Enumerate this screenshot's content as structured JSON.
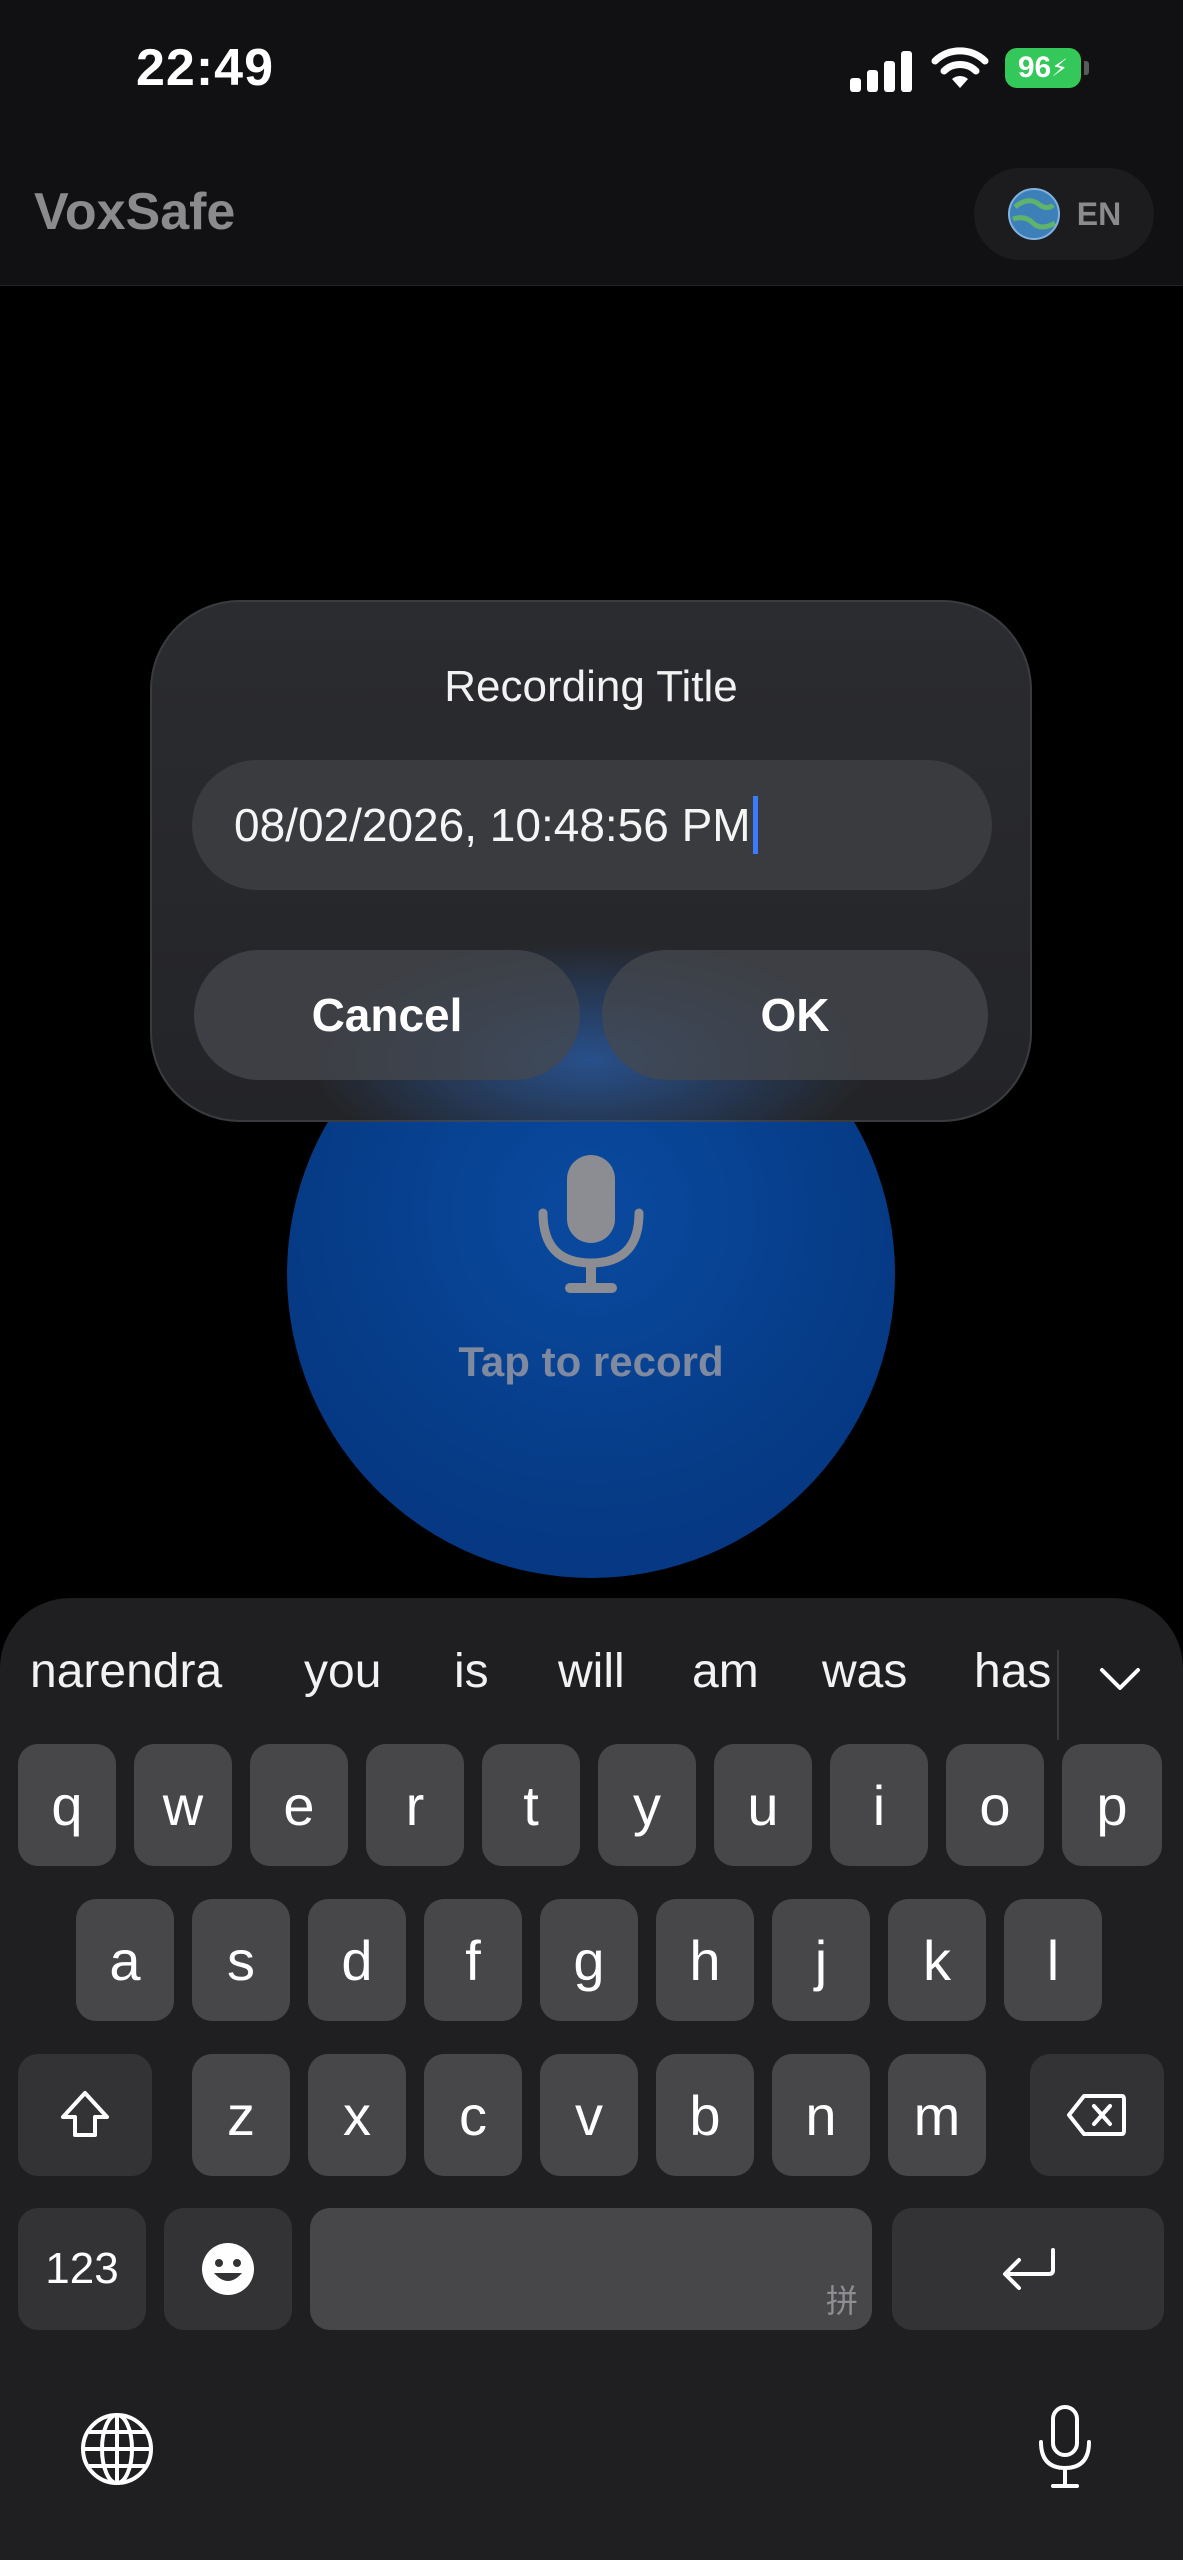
{
  "status_bar": {
    "time": "22:49",
    "battery": "96"
  },
  "header": {
    "app_title": "VoxSafe",
    "language": "EN"
  },
  "main": {
    "tap_to_record": "Tap to record"
  },
  "dialog": {
    "title": "Recording Title",
    "input_value": "08/02/2026, 10:48:56 PM",
    "cancel_label": "Cancel",
    "ok_label": "OK"
  },
  "keyboard": {
    "suggestions": [
      "narendra",
      "you",
      "is",
      "will",
      "am",
      "was",
      "has"
    ],
    "row1": [
      "q",
      "w",
      "e",
      "r",
      "t",
      "y",
      "u",
      "i",
      "o",
      "p"
    ],
    "row2": [
      "a",
      "s",
      "d",
      "f",
      "g",
      "h",
      "j",
      "k",
      "l"
    ],
    "row3": [
      "z",
      "x",
      "c",
      "v",
      "b",
      "n",
      "m"
    ],
    "numbers_label": "123",
    "space_hint": "拼"
  },
  "colors": {
    "accent": "#3b7cff",
    "record": "#063b86",
    "battery": "#34c759"
  }
}
